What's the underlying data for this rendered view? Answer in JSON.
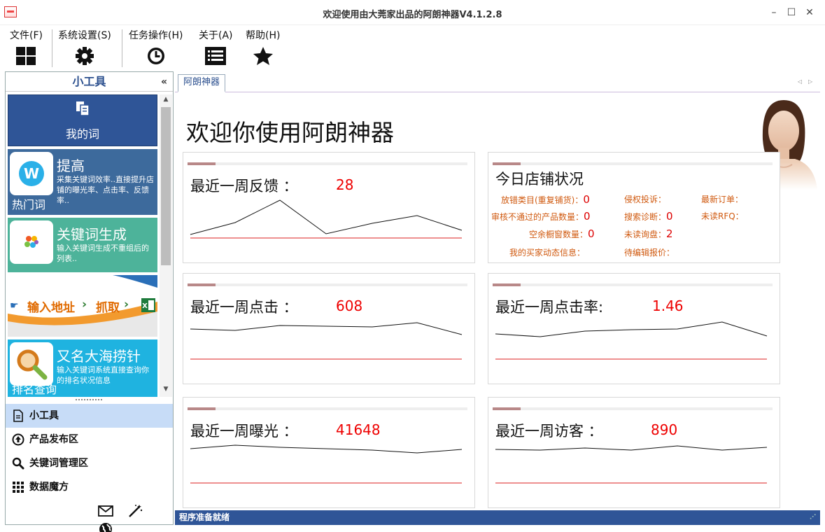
{
  "window": {
    "title": "欢迎使用由大莞家出品的阿朗神器V4.1.2.8"
  },
  "menu": [
    {
      "label": "文件(F)",
      "icon": "grid-icon"
    },
    {
      "label": "系统设置(S)",
      "icon": "gear-icon"
    },
    {
      "label": "任务操作(H)",
      "icon": "clock-icon"
    },
    {
      "label": "关于(A)",
      "icon": "list-icon"
    },
    {
      "label": "帮助(H)",
      "icon": "star-icon"
    }
  ],
  "sidebar": {
    "title": "小工具",
    "tiles": [
      {
        "label": "我的词"
      },
      {
        "title": "提高",
        "desc": "采集关键词效率..直接提升店铺的曝光率、点击率、反馈率..",
        "foot": "热门词"
      },
      {
        "title": "关键词生成",
        "desc": "输入关键词生成不重组后的列表.."
      },
      {
        "part1": "输入地址",
        "part2": "抓取"
      },
      {
        "title": "又名大海捞针",
        "desc": "输入关键词系统直接查询你的排名状况信息",
        "foot": "排名查询"
      }
    ],
    "nav": [
      {
        "label": "小工具"
      },
      {
        "label": "产品发布区"
      },
      {
        "label": "关键词管理区"
      },
      {
        "label": "数据魔方"
      }
    ]
  },
  "tabs": [
    {
      "label": "阿朗神器"
    }
  ],
  "main": {
    "welcome": "欢迎你使用阿朗神器",
    "cards": [
      {
        "title": "最近一周反馈 ：",
        "value": "28"
      },
      {
        "title": "最近一周点击 ：",
        "value": "608"
      },
      {
        "title": "最近一周点击率:",
        "value": "1.46"
      },
      {
        "title": "最近一周曝光 ：",
        "value": "41648"
      },
      {
        "title": "最近一周访客 ：",
        "value": "890"
      }
    ],
    "status": {
      "title": "今日店铺状况",
      "items": [
        {
          "label": "放错类目(重复铺货)：",
          "value": "0"
        },
        {
          "label": "侵权投诉：",
          "value": ""
        },
        {
          "label": "最新订单：",
          "value": ""
        },
        {
          "label": "审核不通过的产品数量：",
          "value": "0"
        },
        {
          "label": "搜索诊断：",
          "value": "0"
        },
        {
          "label": "未读RFQ：",
          "value": ""
        },
        {
          "label": "空余橱窗数量：",
          "value": "0"
        },
        {
          "label": "未读询盘：",
          "value": "2"
        },
        {
          "label": "我的买家动态信息：",
          "value": ""
        },
        {
          "label": "待编辑报价：",
          "value": ""
        }
      ]
    }
  },
  "statusbar": {
    "text": "程序准备就绪"
  },
  "colors": {
    "accent": "#2f5597",
    "value_red": "#e00000",
    "status_orange": "#d05a10"
  }
}
